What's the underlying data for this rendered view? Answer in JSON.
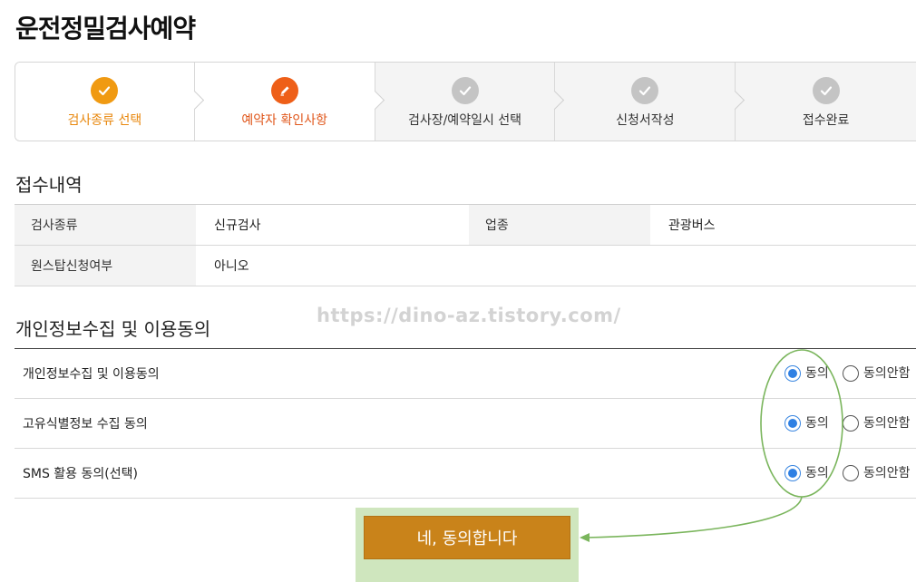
{
  "page": {
    "title": "운전정밀검사예약"
  },
  "stepper": {
    "steps": [
      {
        "label": "검사종류 선택",
        "state": "done",
        "icon": "check-icon"
      },
      {
        "label": "예약자 확인사항",
        "state": "active",
        "icon": "pencil-icon"
      },
      {
        "label": "검사장/예약일시 선택",
        "state": "pending",
        "icon": "check-icon"
      },
      {
        "label": "신청서작성",
        "state": "pending",
        "icon": "check-icon"
      },
      {
        "label": "접수완료",
        "state": "pending",
        "icon": "check-icon"
      }
    ]
  },
  "receipt": {
    "title": "접수내역",
    "rows": [
      [
        {
          "h": "검사종류",
          "v": "신규검사"
        },
        {
          "h": "업종",
          "v": "관광버스"
        }
      ],
      [
        {
          "h": "원스탑신청여부",
          "v": "아니오"
        }
      ]
    ]
  },
  "watermark": "https://dino-az.tistory.com/",
  "consent": {
    "title": "개인정보수집 및 이용동의",
    "agree_label": "동의",
    "disagree_label": "동의안함",
    "items": [
      {
        "label": "개인정보수집 및 이용동의",
        "value": "동의"
      },
      {
        "label": "고유식별정보 수집 동의",
        "value": "동의"
      },
      {
        "label": "SMS 활용 동의(선택)",
        "value": "동의"
      }
    ]
  },
  "submit": {
    "label": "네, 동의합니다"
  },
  "colors": {
    "step_done": "#f09a12",
    "step_active": "#ee5f18",
    "step_pending": "#c4c4c4",
    "button": "#c9831a",
    "radio_checked": "#2f80e3",
    "annotation": "#7ab55c"
  }
}
